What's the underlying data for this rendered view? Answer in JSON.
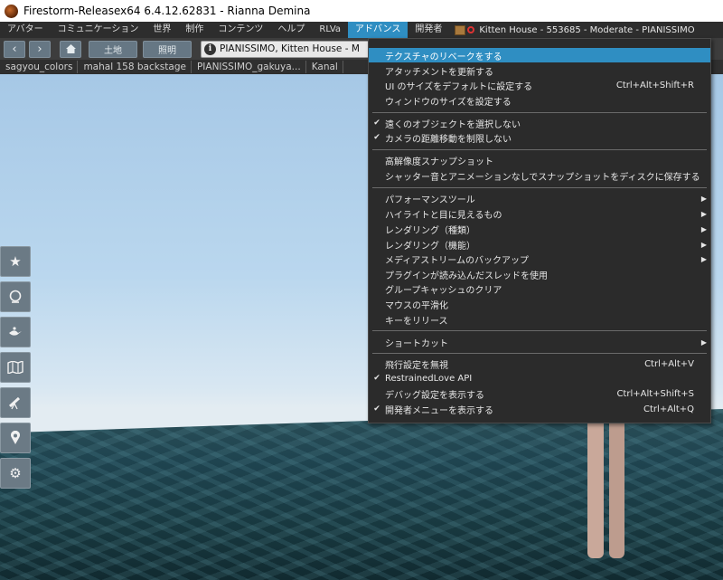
{
  "window": {
    "title": "Firestorm-Releasex64 6.4.12.62831 - Rianna Demina"
  },
  "menubar": {
    "items": [
      "アバター",
      "コミュニケーション",
      "世界",
      "制作",
      "コンテンツ",
      "ヘルプ",
      "RLVa",
      "アドバンス",
      "開発者"
    ],
    "active_index": 7,
    "parcel_info": "Kitten House - 553685 - Moderate - PIANISSIMO"
  },
  "navbar": {
    "back_icon": "left-arrow",
    "forward_icon": "right-arrow",
    "home_icon": "house",
    "land_label": "土地",
    "lighting_label": "照明",
    "location_text": "PIANISSIMO, Kitten House - M"
  },
  "favorites": {
    "items": [
      "sagyou_colors",
      "mahal 158 backstage",
      "PIANISSIMO_gakuya...",
      "Kanal"
    ]
  },
  "advanced_menu": {
    "items": [
      {
        "label": "テクスチャのリベークをする",
        "shortcut": "",
        "checked": false,
        "submenu": false,
        "highlight": true
      },
      {
        "label": "アタッチメントを更新する",
        "shortcut": "",
        "checked": false,
        "submenu": false
      },
      {
        "label": "UI のサイズをデフォルトに設定する",
        "shortcut": "Ctrl+Alt+Shift+R",
        "checked": false,
        "submenu": false
      },
      {
        "label": "ウィンドウのサイズを設定する",
        "shortcut": "",
        "checked": false,
        "submenu": false
      },
      {
        "separator": true
      },
      {
        "label": "遠くのオブジェクトを選択しない",
        "shortcut": "",
        "checked": true,
        "submenu": false
      },
      {
        "label": "カメラの距離移動を制限しない",
        "shortcut": "",
        "checked": true,
        "submenu": false
      },
      {
        "separator": true
      },
      {
        "label": "高解像度スナップショット",
        "shortcut": "",
        "checked": false,
        "submenu": false
      },
      {
        "label": "シャッター音とアニメーションなしでスナップショットをディスクに保存する",
        "shortcut": "",
        "checked": false,
        "submenu": false
      },
      {
        "separator": true
      },
      {
        "label": "パフォーマンスツール",
        "shortcut": "",
        "checked": false,
        "submenu": true
      },
      {
        "label": "ハイライトと目に見えるもの",
        "shortcut": "",
        "checked": false,
        "submenu": true
      },
      {
        "label": "レンダリング（種類）",
        "shortcut": "",
        "checked": false,
        "submenu": true
      },
      {
        "label": "レンダリング（機能）",
        "shortcut": "",
        "checked": false,
        "submenu": true
      },
      {
        "label": "メディアストリームのバックアップ",
        "shortcut": "",
        "checked": false,
        "submenu": true
      },
      {
        "label": "プラグインが読み込んだスレッドを使用",
        "shortcut": "",
        "checked": false,
        "submenu": false
      },
      {
        "label": "グループキャッシュのクリア",
        "shortcut": "",
        "checked": false,
        "submenu": false
      },
      {
        "label": "マウスの平滑化",
        "shortcut": "",
        "checked": false,
        "submenu": false
      },
      {
        "label": "キーをリリース",
        "shortcut": "",
        "checked": false,
        "submenu": false
      },
      {
        "separator": true
      },
      {
        "label": "ショートカット",
        "shortcut": "",
        "checked": false,
        "submenu": true
      },
      {
        "separator": true
      },
      {
        "label": "飛行設定を無視",
        "shortcut": "Ctrl+Alt+V",
        "checked": false,
        "submenu": false
      },
      {
        "label": "RestrainedLove API",
        "shortcut": "",
        "checked": true,
        "submenu": false
      },
      {
        "label": "デバッグ設定を表示する",
        "shortcut": "Ctrl+Alt+Shift+S",
        "checked": false,
        "submenu": false
      },
      {
        "label": "開発者メニューを表示する",
        "shortcut": "Ctrl+Alt+Q",
        "checked": true,
        "submenu": false
      }
    ]
  },
  "left_toolbar": {
    "buttons": [
      "star-icon",
      "globe-icon",
      "genie-lamp-icon",
      "map-icon",
      "telescope-icon",
      "location-pin-icon",
      "gears-icon"
    ]
  },
  "colors": {
    "accent": "#2f8ec2",
    "menu_bg": "#2b2b2b",
    "button_bg": "#667784"
  }
}
